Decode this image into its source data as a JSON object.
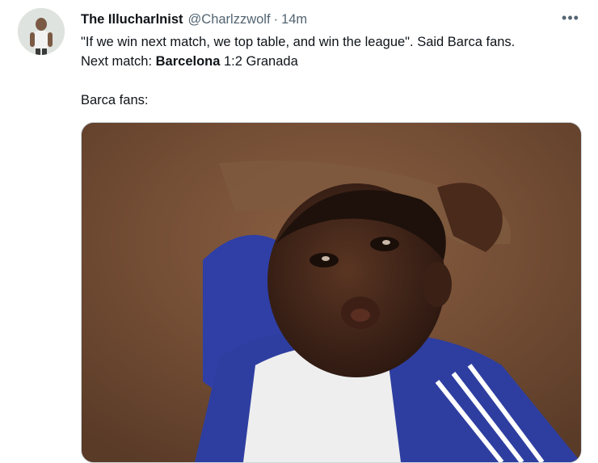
{
  "tweet": {
    "author_name": "The Illucharlnist",
    "author_handle": "@Charlzzwolf",
    "separator": "·",
    "timestamp": "14m",
    "more_icon": "more-horizontal-icon",
    "text_line_1": "\"If we win next match, we top table, and win the league\". Said Barca fans.",
    "text_line_2_prefix": "Next match: ",
    "text_line_2_team": "Barcelona",
    "text_line_2_suffix": " 1:2 Granada",
    "text_line_3": "Barca fans:"
  },
  "colors": {
    "text": "#0f1419",
    "secondary": "#536471",
    "border": "#cfd9de",
    "jacket_blue": "#2f3fa6",
    "background_brown": "#7a5237"
  }
}
